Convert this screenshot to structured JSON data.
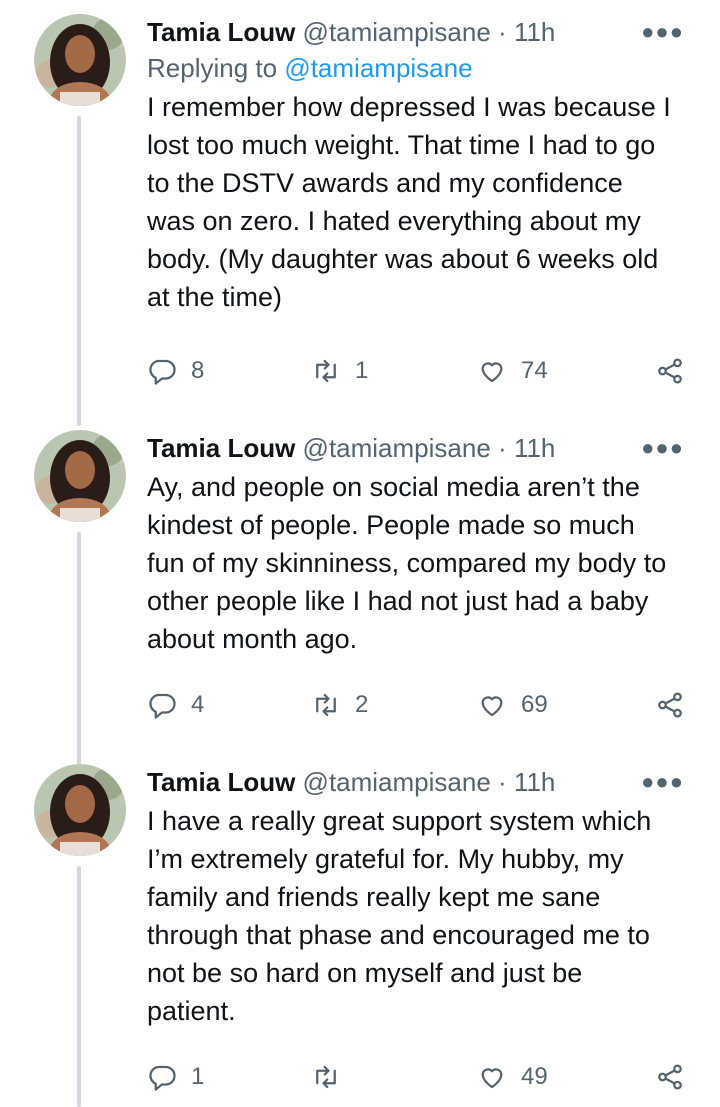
{
  "tweets": [
    {
      "name": "Tamia Louw",
      "handle": "@tamiampisane",
      "separator": "·",
      "time": "11h",
      "replying_prefix": "Replying to",
      "replying_to": "@tamiampisane",
      "lines": [
        "I remember how depressed I was because I",
        "lost too much weight. That time I had to go",
        "to the DSTV awards and my confidence",
        "was on zero. I hated everything about my",
        "body. (My daughter was about 6 weeks old",
        "at the time)"
      ],
      "replies": "8",
      "retweets": "1",
      "likes": "74"
    },
    {
      "name": "Tamia Louw",
      "handle": "@tamiampisane",
      "separator": "·",
      "time": "11h",
      "lines": [
        "Ay, and people on social media aren’t the",
        "kindest of people. People made so much",
        "fun of my skinniness, compared my body to",
        "other people like I had not just had a baby",
        "about month ago."
      ],
      "replies": "4",
      "retweets": "2",
      "likes": "69"
    },
    {
      "name": "Tamia Louw",
      "handle": "@tamiampisane",
      "separator": "·",
      "time": "11h",
      "lines": [
        "I have a really great support system which",
        "I’m extremely grateful for. My hubby, my",
        "family and friends really kept me sane",
        "through that phase and encouraged me to",
        "not be so hard on myself and just be",
        "patient."
      ],
      "replies": "1",
      "retweets": "",
      "likes": "49"
    }
  ],
  "icons": {
    "more": "more-horizontal-icon",
    "reply": "reply-icon",
    "retweet": "retweet-icon",
    "like": "like-icon",
    "share": "share-icon"
  },
  "colors": {
    "text": "#0f1419",
    "secondary": "#536471",
    "link": "#1d9bf0",
    "thread_line": "#cfd9de"
  }
}
